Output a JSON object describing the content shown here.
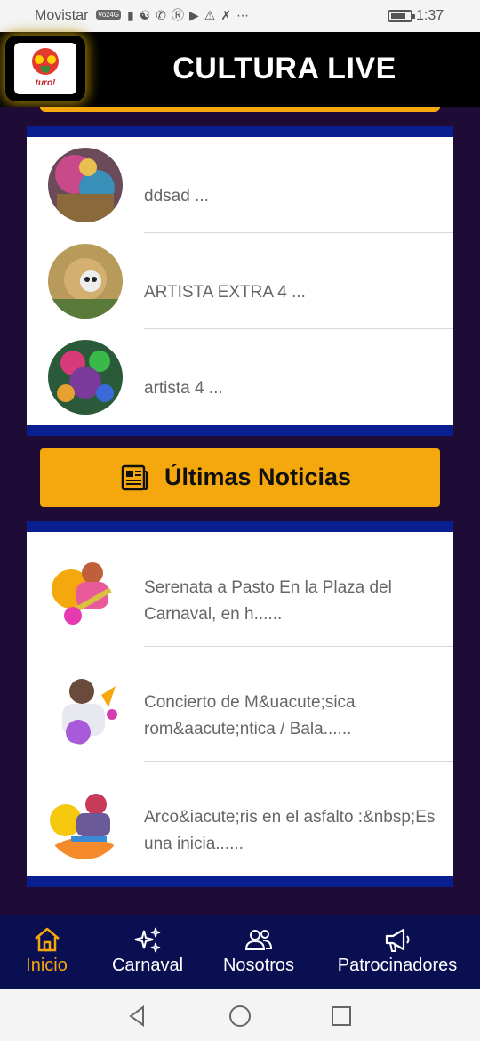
{
  "status_bar": {
    "carrier": "Movistar",
    "network_badge": "Voz4G",
    "time": "1:37",
    "icons": [
      "signal-icon",
      "wifi-icon",
      "missed-call-icon",
      "bitcoin-icon",
      "youtube-icon",
      "warning-icon",
      "tools-icon",
      "more-icon"
    ]
  },
  "header": {
    "logo_text": "turo!",
    "title": "CULTURA LIVE"
  },
  "artists": [
    {
      "name": "ddsad ..."
    },
    {
      "name": "ARTISTA EXTRA 4 ..."
    },
    {
      "name": "artista 4 ..."
    }
  ],
  "news_section": {
    "button_label": "Últimas Noticias"
  },
  "news": [
    {
      "title": "Serenata a Pasto En la Plaza del Carnaval, en h......"
    },
    {
      "title": "Concierto de M&uacute;sica rom&aacute;ntica / Bala......"
    },
    {
      "title": "Arco&iacute;ris en el asfalto :&nbsp;Es una inicia......"
    }
  ],
  "bottom_nav": [
    {
      "label": "Inicio",
      "icon": "home-icon",
      "active": true
    },
    {
      "label": "Carnaval",
      "icon": "sparkles-icon",
      "active": false
    },
    {
      "label": "Nosotros",
      "icon": "users-icon",
      "active": false
    },
    {
      "label": "Patrocinadores",
      "icon": "megaphone-icon",
      "active": false
    }
  ],
  "colors": {
    "accent": "#f5a80d",
    "card_border": "#0a1f8f",
    "background": "#1e0b36",
    "nav_background": "#0a0f52"
  }
}
